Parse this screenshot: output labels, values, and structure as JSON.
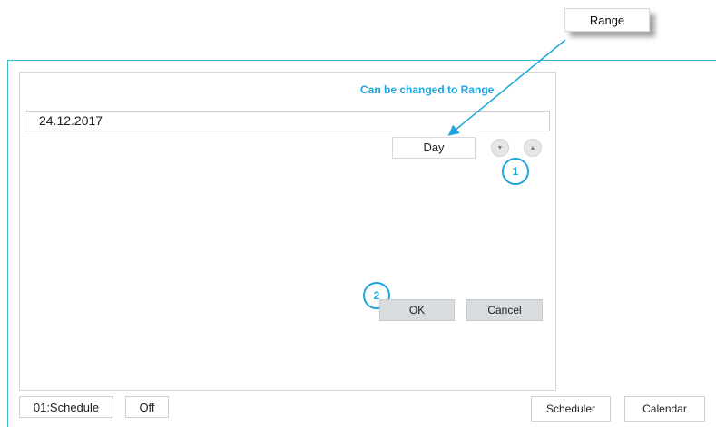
{
  "callout": {
    "range_label": "Range",
    "hint_text": "Can be changed to Range"
  },
  "dialog": {
    "date_value": "24.12.2017",
    "mode_value": "Day",
    "down_icon": "▼",
    "up_icon": "▲",
    "ok_label": "OK",
    "cancel_label": "Cancel"
  },
  "badges": {
    "step1": "1",
    "step2": "2"
  },
  "footer": {
    "schedule_label": "01:Schedule",
    "off_label": "Off",
    "scheduler_label": "Scheduler",
    "calendar_label": "Calendar"
  },
  "colors": {
    "accent": "#1da6dd",
    "frame": "#3fb7dc",
    "button_grey": "#d9dcdf"
  }
}
